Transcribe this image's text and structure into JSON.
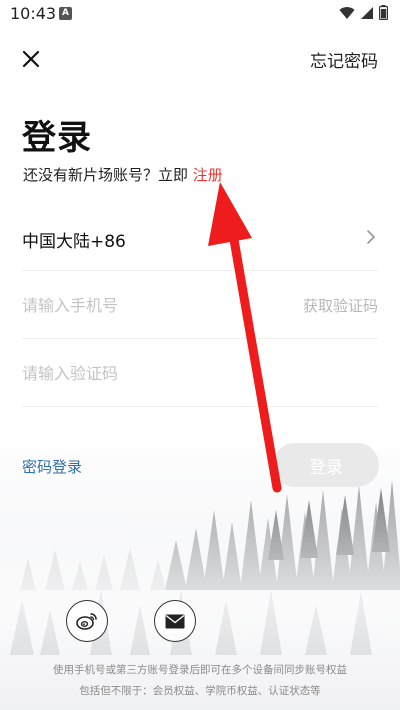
{
  "status_bar": {
    "time": "10:43",
    "notification_badge": "A"
  },
  "header": {
    "close_icon": "close-icon",
    "forgot_password": "忘记密码"
  },
  "main": {
    "title": "登录",
    "subtitle_prefix": "还没有新片场账号？立即 ",
    "register_link": "注册",
    "country": "中国大陆+86",
    "phone_placeholder": "请输入手机号",
    "get_code": "获取验证码",
    "code_placeholder": "请输入验证码",
    "password_login": "密码登录",
    "login_button": "登录"
  },
  "social": {
    "weibo_icon": "weibo-icon",
    "mail_icon": "mail-icon"
  },
  "footer": {
    "line1": "使用手机号或第三方账号登录后即可在多个设备间同步账号权益",
    "line2": "包括但不限于：会员权益、学院币权益、认证状态等"
  },
  "colors": {
    "register": "#e53935",
    "password_login": "#2f6fb0",
    "login_button_bg": "#e9e9e9",
    "arrow": "#ee1c1c"
  }
}
